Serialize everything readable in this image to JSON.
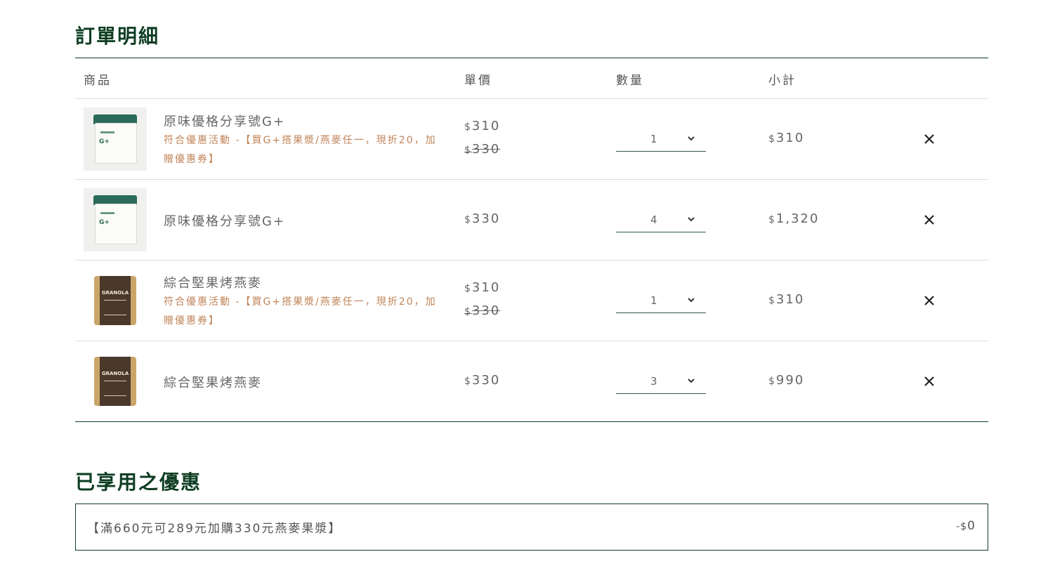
{
  "order": {
    "title": "訂單明細",
    "headers": {
      "product": "商品",
      "unit_price": "單價",
      "quantity": "數量",
      "subtotal": "小計"
    },
    "currency": "$",
    "rows": [
      {
        "name": "原味優格分享號G+",
        "image": "yogurt",
        "promo": "符合優惠活動 -【買G+搭果漿/燕麥任一，現折20，加贈優惠券】",
        "price": "310",
        "original_price": "330",
        "qty": "1",
        "subtotal": "310"
      },
      {
        "name": "原味優格分享號G+",
        "image": "yogurt",
        "promo": "",
        "price": "330",
        "original_price": "",
        "qty": "4",
        "subtotal": "1,320"
      },
      {
        "name": "綜合堅果烤燕麥",
        "image": "granola",
        "promo": "符合優惠活動 -【買G+搭果漿/燕麥任一，現折20，加贈優惠券】",
        "price": "310",
        "original_price": "330",
        "qty": "1",
        "subtotal": "310"
      },
      {
        "name": "綜合堅果烤燕麥",
        "image": "granola",
        "promo": "",
        "price": "330",
        "original_price": "",
        "qty": "3",
        "subtotal": "990"
      }
    ]
  },
  "coupons": {
    "title": "已享用之優惠",
    "items": [
      {
        "name": "【滿660元可289元加購330元燕麥果漿】",
        "discount_prefix": "-",
        "currency": "$",
        "amount": "0"
      }
    ]
  },
  "icons": {
    "remove": "close-icon",
    "dropdown": "chevron-down-icon"
  },
  "colors": {
    "title": "#0e3d22",
    "promo": "#c0845a",
    "text": "#666666",
    "border": "#0e3d22"
  }
}
